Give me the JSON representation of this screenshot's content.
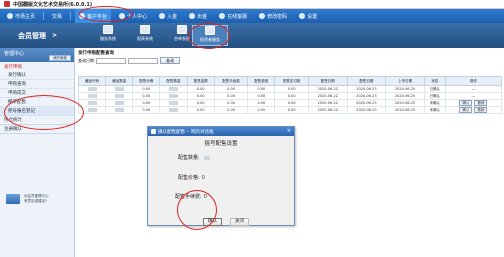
{
  "window": {
    "title": "中国翻版文化艺术交易所(6.0.0.1)"
  },
  "topnav": {
    "items": [
      {
        "label": "市场主页",
        "icon": "home-icon"
      },
      {
        "label": "交易",
        "icon": "trade-icon"
      },
      {
        "label": "客户平台",
        "icon": "client-icon"
      },
      {
        "label": "个人中心",
        "icon": "user-icon"
      },
      {
        "label": "入金",
        "icon": "deposit-icon"
      },
      {
        "label": "出金",
        "icon": "withdraw-icon"
      },
      {
        "label": "在线客服",
        "icon": "support-icon"
      },
      {
        "label": "修改密码",
        "icon": "key-icon"
      },
      {
        "label": "设置",
        "icon": "gear-icon"
      }
    ]
  },
  "header": {
    "member_title": "会员管理",
    "chevron": ">",
    "tools": [
      {
        "label": "服务系统"
      },
      {
        "label": "报表系统"
      },
      {
        "label": "合单系统"
      },
      {
        "label": "投资者服务"
      }
    ]
  },
  "sidebar": {
    "title": "管理中心",
    "home_button": "我的面板",
    "group1": "发行申购",
    "items": [
      "发行确认",
      "申购查询",
      "申购成交",
      "撤单配售",
      "摇号报名登记"
    ],
    "group2": "持仓统计",
    "group3": "注册确认",
    "promo": [
      "对会员管理中心",
      "有意见或建议?"
    ]
  },
  "main": {
    "breadcrumb": "发行申购配售查询",
    "query_label": "查询日期",
    "query_button": "查询",
    "table": {
      "headers": [
        "藏品代码",
        "藏品数量",
        "配售价格",
        "配售数量",
        "配售金额",
        "配售手续费",
        "配售费用",
        "配售实付款",
        "配售日期",
        "配售日期",
        "上市日期",
        "状态",
        "操作"
      ],
      "rows": [
        [
          "",
          "",
          "0.00",
          "",
          "0.00",
          "0.00",
          "0.00",
          "0.00",
          "2020-06-22",
          "2020-06-23",
          "2020-06-25",
          "已确认",
          "—"
        ],
        [
          "",
          "",
          "0.00",
          "",
          "0.00",
          "0.00",
          "0.00",
          "0.00",
          "2020-06-22",
          "2020-06-23",
          "2020-06-25",
          "已确认",
          "—"
        ],
        [
          "",
          "",
          "0.00",
          "",
          "0.00",
          "0.00",
          "0.00",
          "0.00",
          "2020-06-22",
          "2020-06-23",
          "2020-06-25",
          "未确认",
          "确认|撤销"
        ],
        [
          "",
          "",
          "0.00",
          "",
          "0.00",
          "0.00",
          "0.00",
          "0.00",
          "2020-06-22",
          "2020-06-23",
          "2020-06-25",
          "未确认",
          "确认|撤销"
        ]
      ]
    }
  },
  "dialog": {
    "title": "确认配售配售 -- 网页对话框",
    "heading": "摇号配售设置",
    "fields": [
      {
        "label": "配售数量:",
        "value": ""
      },
      {
        "label": "配售价格:",
        "value": "0"
      },
      {
        "label": "配售手续费:",
        "value": "0"
      }
    ],
    "ok": "确认",
    "close": "关闭"
  }
}
